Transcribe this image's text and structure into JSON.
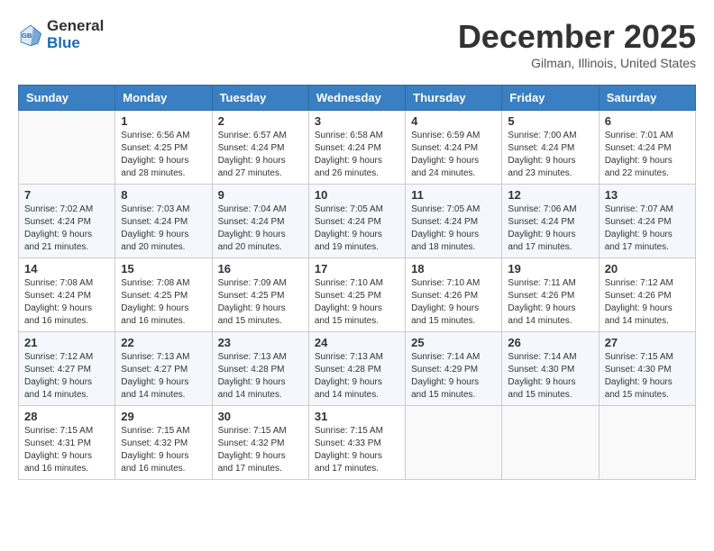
{
  "logo": {
    "line1": "General",
    "line2": "Blue"
  },
  "title": "December 2025",
  "location": "Gilman, Illinois, United States",
  "weekdays": [
    "Sunday",
    "Monday",
    "Tuesday",
    "Wednesday",
    "Thursday",
    "Friday",
    "Saturday"
  ],
  "weeks": [
    [
      {
        "day": "",
        "info": ""
      },
      {
        "day": "1",
        "info": "Sunrise: 6:56 AM\nSunset: 4:25 PM\nDaylight: 9 hours\nand 28 minutes."
      },
      {
        "day": "2",
        "info": "Sunrise: 6:57 AM\nSunset: 4:24 PM\nDaylight: 9 hours\nand 27 minutes."
      },
      {
        "day": "3",
        "info": "Sunrise: 6:58 AM\nSunset: 4:24 PM\nDaylight: 9 hours\nand 26 minutes."
      },
      {
        "day": "4",
        "info": "Sunrise: 6:59 AM\nSunset: 4:24 PM\nDaylight: 9 hours\nand 24 minutes."
      },
      {
        "day": "5",
        "info": "Sunrise: 7:00 AM\nSunset: 4:24 PM\nDaylight: 9 hours\nand 23 minutes."
      },
      {
        "day": "6",
        "info": "Sunrise: 7:01 AM\nSunset: 4:24 PM\nDaylight: 9 hours\nand 22 minutes."
      }
    ],
    [
      {
        "day": "7",
        "info": "Sunrise: 7:02 AM\nSunset: 4:24 PM\nDaylight: 9 hours\nand 21 minutes."
      },
      {
        "day": "8",
        "info": "Sunrise: 7:03 AM\nSunset: 4:24 PM\nDaylight: 9 hours\nand 20 minutes."
      },
      {
        "day": "9",
        "info": "Sunrise: 7:04 AM\nSunset: 4:24 PM\nDaylight: 9 hours\nand 20 minutes."
      },
      {
        "day": "10",
        "info": "Sunrise: 7:05 AM\nSunset: 4:24 PM\nDaylight: 9 hours\nand 19 minutes."
      },
      {
        "day": "11",
        "info": "Sunrise: 7:05 AM\nSunset: 4:24 PM\nDaylight: 9 hours\nand 18 minutes."
      },
      {
        "day": "12",
        "info": "Sunrise: 7:06 AM\nSunset: 4:24 PM\nDaylight: 9 hours\nand 17 minutes."
      },
      {
        "day": "13",
        "info": "Sunrise: 7:07 AM\nSunset: 4:24 PM\nDaylight: 9 hours\nand 17 minutes."
      }
    ],
    [
      {
        "day": "14",
        "info": "Sunrise: 7:08 AM\nSunset: 4:24 PM\nDaylight: 9 hours\nand 16 minutes."
      },
      {
        "day": "15",
        "info": "Sunrise: 7:08 AM\nSunset: 4:25 PM\nDaylight: 9 hours\nand 16 minutes."
      },
      {
        "day": "16",
        "info": "Sunrise: 7:09 AM\nSunset: 4:25 PM\nDaylight: 9 hours\nand 15 minutes."
      },
      {
        "day": "17",
        "info": "Sunrise: 7:10 AM\nSunset: 4:25 PM\nDaylight: 9 hours\nand 15 minutes."
      },
      {
        "day": "18",
        "info": "Sunrise: 7:10 AM\nSunset: 4:26 PM\nDaylight: 9 hours\nand 15 minutes."
      },
      {
        "day": "19",
        "info": "Sunrise: 7:11 AM\nSunset: 4:26 PM\nDaylight: 9 hours\nand 14 minutes."
      },
      {
        "day": "20",
        "info": "Sunrise: 7:12 AM\nSunset: 4:26 PM\nDaylight: 9 hours\nand 14 minutes."
      }
    ],
    [
      {
        "day": "21",
        "info": "Sunrise: 7:12 AM\nSunset: 4:27 PM\nDaylight: 9 hours\nand 14 minutes."
      },
      {
        "day": "22",
        "info": "Sunrise: 7:13 AM\nSunset: 4:27 PM\nDaylight: 9 hours\nand 14 minutes."
      },
      {
        "day": "23",
        "info": "Sunrise: 7:13 AM\nSunset: 4:28 PM\nDaylight: 9 hours\nand 14 minutes."
      },
      {
        "day": "24",
        "info": "Sunrise: 7:13 AM\nSunset: 4:28 PM\nDaylight: 9 hours\nand 14 minutes."
      },
      {
        "day": "25",
        "info": "Sunrise: 7:14 AM\nSunset: 4:29 PM\nDaylight: 9 hours\nand 15 minutes."
      },
      {
        "day": "26",
        "info": "Sunrise: 7:14 AM\nSunset: 4:30 PM\nDaylight: 9 hours\nand 15 minutes."
      },
      {
        "day": "27",
        "info": "Sunrise: 7:15 AM\nSunset: 4:30 PM\nDaylight: 9 hours\nand 15 minutes."
      }
    ],
    [
      {
        "day": "28",
        "info": "Sunrise: 7:15 AM\nSunset: 4:31 PM\nDaylight: 9 hours\nand 16 minutes."
      },
      {
        "day": "29",
        "info": "Sunrise: 7:15 AM\nSunset: 4:32 PM\nDaylight: 9 hours\nand 16 minutes."
      },
      {
        "day": "30",
        "info": "Sunrise: 7:15 AM\nSunset: 4:32 PM\nDaylight: 9 hours\nand 17 minutes."
      },
      {
        "day": "31",
        "info": "Sunrise: 7:15 AM\nSunset: 4:33 PM\nDaylight: 9 hours\nand 17 minutes."
      },
      {
        "day": "",
        "info": ""
      },
      {
        "day": "",
        "info": ""
      },
      {
        "day": "",
        "info": ""
      }
    ]
  ]
}
